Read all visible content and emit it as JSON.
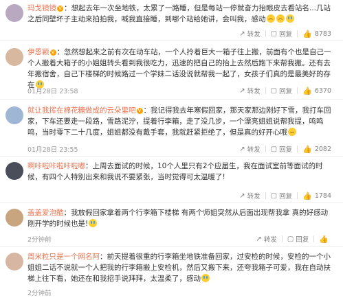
{
  "actions": {
    "share": "转发",
    "reply": "回复"
  },
  "comments": [
    {
      "user": "玛戈镜镜",
      "text": "想起去年一次坐地铁，太累了一路睡，但是每站一停就奋力抬眼皮去看站名...几站之后同壁坏子主动来拍拍我，喊我直接睡，到哪个站给她讲，会叫我，感动",
      "likes": "8783",
      "avatar_color": "#b8a9c0"
    },
    {
      "user": "伊恩颖",
      "text": "忽然想起来之前有次在动车站，一个人拎着巨大一箱子往上搬，前面有个也是自己一个人搬着大箱子的小姐姐转头看到我很吃力，迅速的把自己的抬上去然后跑下来帮我搬。还有去年搬宿舍，自己下楼梯的时候路过一个学妹二话没说就帮我一起了，女孩子们真的是最美好的存在",
      "time": "01月28日 23:58",
      "likes": "6370",
      "avatar_color": "#d9b8a0"
    },
    {
      "user": "就让我挥在棉花糖做成的云朵里吧",
      "text": "我记得我去年寒假回家，那天家那边刚好下雪，我打车回家，下车还要走一段路，雪路泥泞，提着行李箱，走了没几步，一个漂亮姐姐说帮我提，鸣鸣鸣，当时零下二十几度，姐姐都没有戴手套，我就赶紧拒绝了，但是真的好开心哦",
      "time": "01月28日 23:55",
      "likes": "2082",
      "avatar_color": "#9fb7d4"
    },
    {
      "user": "啊咔啦咔啦咔啦嘟",
      "text": "上周去面试的时候，10个人里只有2个应届生，我在面试室前等面试的时候，有四个人特别出来和我说不要紧张，当时觉得可太温暖了!",
      "likes": "1784",
      "avatar_color": "#4a4e5a"
    },
    {
      "user": "盖盖爱泡酷",
      "text": "我放假回家拿着两个行李箱下楼梯 有两个师姐突然从后面出现帮我拿 真的好感动 刚开学的时候也是!",
      "time": "2分钟前",
      "likes": "",
      "avatar_color": "#c9a57f"
    },
    {
      "user": "周米粒只是一个网名阿",
      "text": "前天提着很重的行李箱坐地铁准备回家，过安检的时候，安检的一个小姐姐二话不说就一个人把我的行李箱搬上安检机，然后又搬下来，还夸我箱子可爱，我在自动扶梯上往下看，她还在和我招手说拜拜，太温柔了，感动",
      "time": "2分钟前",
      "likes": "",
      "avatar_color": "#d7b6a3"
    }
  ]
}
